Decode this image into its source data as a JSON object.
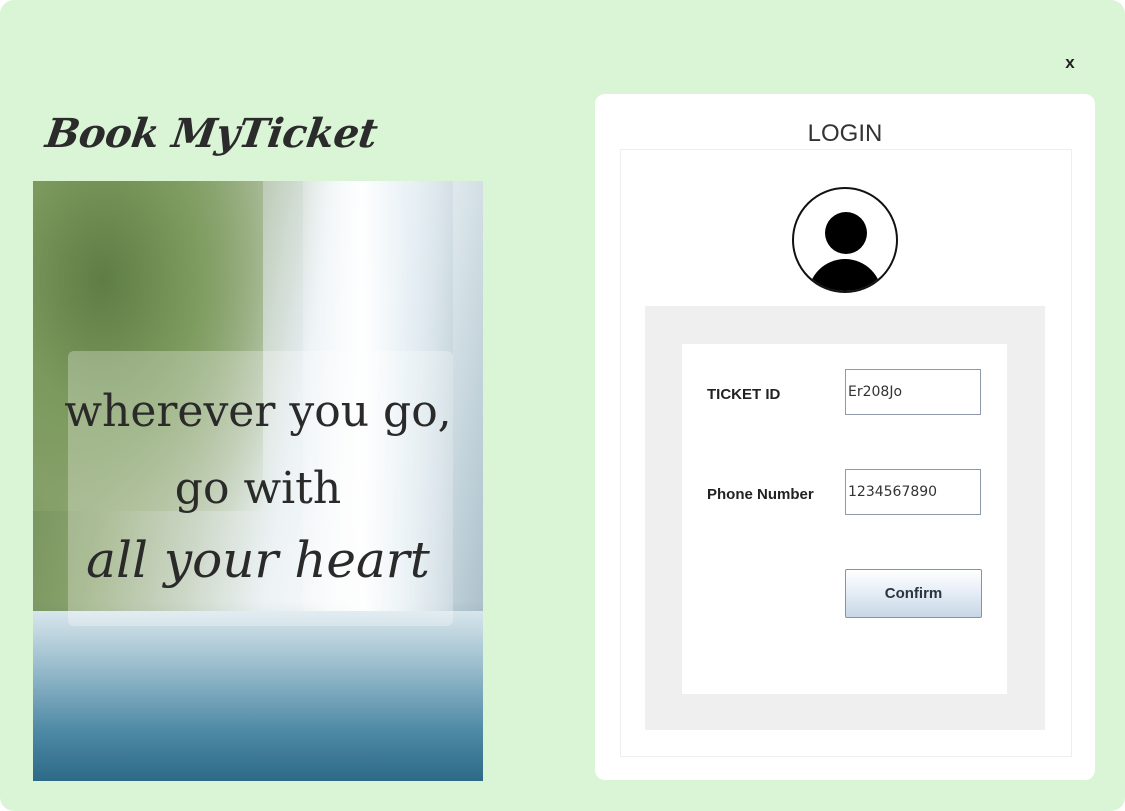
{
  "window": {
    "close_label": "x"
  },
  "brand": {
    "title": "Book MyTicket"
  },
  "poster": {
    "line1": "wherever you go,",
    "line2": "go with",
    "line3": "all your heart"
  },
  "login": {
    "title": "LOGIN",
    "ticket_label": "TICKET ID",
    "ticket_value": "Er208Jo",
    "phone_label": "Phone Number",
    "phone_value": "1234567890",
    "confirm_label": "Confirm"
  },
  "icons": {
    "avatar": "user-avatar-icon",
    "close": "close-icon"
  },
  "colors": {
    "background": "#d9f5d5",
    "card": "#ffffff",
    "panel_grey": "#efefef"
  }
}
